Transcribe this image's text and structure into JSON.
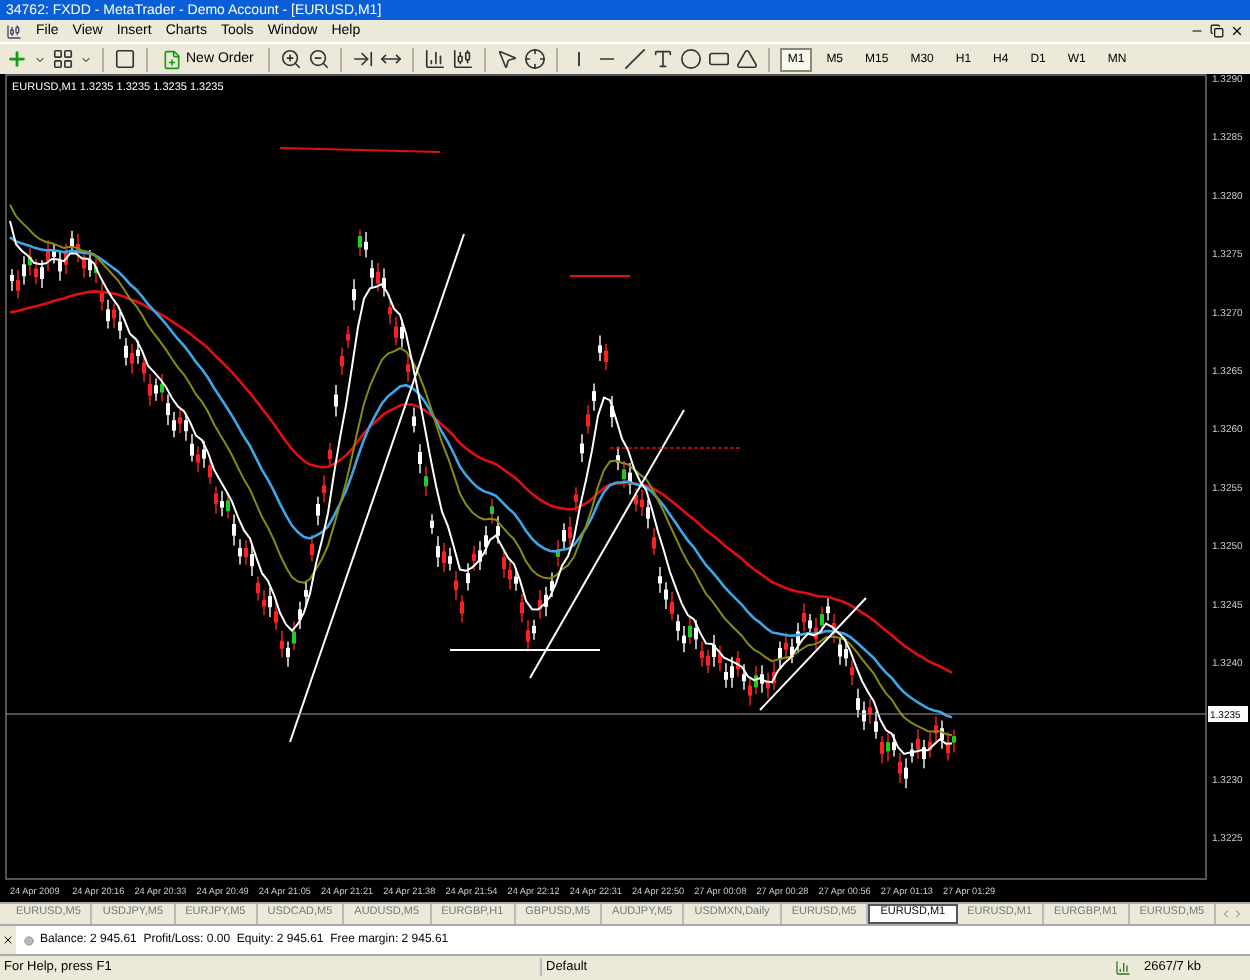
{
  "window": {
    "title": "34762: FXDD - MetaTrader - Demo Account - [EURUSD,M1]"
  },
  "menu": [
    "File",
    "View",
    "Insert",
    "Charts",
    "Tools",
    "Window",
    "Help"
  ],
  "toolbar": {
    "new_order": "New Order",
    "timeframes": [
      {
        "label": "M1",
        "selected": true
      },
      {
        "label": "M5",
        "selected": false
      },
      {
        "label": "M15",
        "selected": false
      },
      {
        "label": "M30",
        "selected": false
      },
      {
        "label": "H1",
        "selected": false
      },
      {
        "label": "H4",
        "selected": false
      },
      {
        "label": "D1",
        "selected": false
      },
      {
        "label": "W1",
        "selected": false
      },
      {
        "label": "MN",
        "selected": false
      }
    ]
  },
  "chart": {
    "legend": "EURUSD,M1  1.3235 1.3235 1.3235 1.3235",
    "price_axis": [
      "1.3290",
      "1.3285",
      "1.3280",
      "1.3275",
      "1.3270",
      "1.3265",
      "1.3260",
      "1.3255",
      "1.3250",
      "1.3245",
      "1.3240",
      "1.3230",
      "1.3225"
    ],
    "current_price": "1.3235",
    "time_axis": [
      "24 Apr 2009",
      "24 Apr 20:16",
      "24 Apr 20:33",
      "24 Apr 20:49",
      "24 Apr 21:05",
      "24 Apr 21:21",
      "24 Apr 21:38",
      "24 Apr 21:54",
      "24 Apr 22:12",
      "24 Apr 22:31",
      "24 Apr 22:50",
      "27 Apr 00:08",
      "27 Apr 00:28",
      "27 Apr 00:56",
      "27 Apr 01:13",
      "27 Apr 01:29"
    ]
  },
  "chart_tabs": [
    {
      "label": "EURUSD,M5",
      "selected": false
    },
    {
      "label": "USDJPY,M5",
      "selected": false
    },
    {
      "label": "EURJPY,M5",
      "selected": false
    },
    {
      "label": "USDCAD,M5",
      "selected": false
    },
    {
      "label": "AUDUSD,M5",
      "selected": false
    },
    {
      "label": "EURGBP,H1",
      "selected": false
    },
    {
      "label": "GBPUSD,M5",
      "selected": false
    },
    {
      "label": "AUDJPY,M5",
      "selected": false
    },
    {
      "label": "USDMXN,Daily",
      "selected": false
    },
    {
      "label": "EURUSD,M5",
      "selected": false
    },
    {
      "label": "EURUSD,M1",
      "selected": true
    },
    {
      "label": "EURUSD,M1",
      "selected": false
    },
    {
      "label": "EURGBP,M1",
      "selected": false
    },
    {
      "label": "EURUSD,M5",
      "selected": false
    }
  ],
  "terminal": {
    "summary": "Balance: 2 945.61  Profit/Loss: 0.00  Equity: 2 945.61  Free margin: 2 945.61"
  },
  "status_bar": {
    "help": "For Help, press F1",
    "profile": "Default",
    "traffic": "2667/7 kb"
  }
}
